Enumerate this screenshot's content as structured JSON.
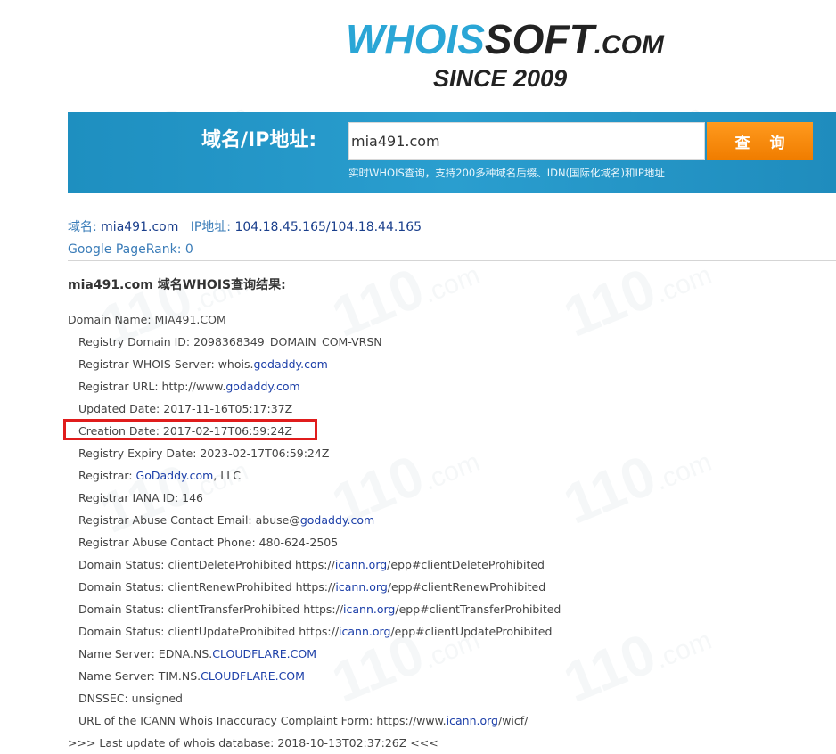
{
  "logo": {
    "whois": "WHOIS",
    "soft": "SOFT",
    "com": ".COM",
    "since": "SINCE 2009"
  },
  "watermark": {
    "text": "110",
    "suffix": ".com"
  },
  "search": {
    "label": "域名/IP地址:",
    "value": "mia491.com",
    "button": "查 询",
    "hint": "实时WHOIS查询，支持200多种域名后缀、IDN(国际化域名)和IP地址"
  },
  "domain_info": {
    "domain_label": "域名:",
    "domain_value": "mia491.com",
    "ip_label": "IP地址:",
    "ip_value": "104.18.45.165/104.18.44.165",
    "pagerank_label": "Google PageRank:",
    "pagerank_value": "0"
  },
  "result_title": "mia491.com 域名WHOIS查询结果:",
  "whois": {
    "domain_name": "Domain Name: MIA491.COM",
    "registry_domain_id": "Registry Domain ID: 2098368349_DOMAIN_COM-VRSN",
    "whois_server_prefix": "Registrar WHOIS Server: whois.",
    "whois_server_link": "godaddy.com",
    "registrar_url_prefix": "Registrar URL: http://www.",
    "registrar_url_link": "godaddy.com",
    "updated_date": "Updated Date: 2017-11-16T05:17:37Z",
    "creation_date": "Creation Date: 2017-02-17T06:59:24Z",
    "expiry_date": "Registry Expiry Date: 2023-02-17T06:59:24Z",
    "registrar_prefix": "Registrar: ",
    "registrar_link": "GoDaddy.com",
    "registrar_suffix": ", LLC",
    "iana_id": "Registrar IANA ID: 146",
    "abuse_email_prefix": "Registrar Abuse Contact Email: abuse@",
    "abuse_email_link": "godaddy.com",
    "abuse_phone": "Registrar Abuse Contact Phone: 480-624-2505",
    "statuses": [
      {
        "prefix": "Domain Status: clientDeleteProhibited https://",
        "link": "icann.org",
        "suffix": "/epp#clientDeleteProhibited"
      },
      {
        "prefix": "Domain Status: clientRenewProhibited https://",
        "link": "icann.org",
        "suffix": "/epp#clientRenewProhibited"
      },
      {
        "prefix": "Domain Status: clientTransferProhibited https://",
        "link": "icann.org",
        "suffix": "/epp#clientTransferProhibited"
      },
      {
        "prefix": "Domain Status: clientUpdateProhibited https://",
        "link": "icann.org",
        "suffix": "/epp#clientUpdateProhibited"
      }
    ],
    "name_servers": [
      {
        "prefix": "Name Server: EDNA.NS.",
        "link": "CLOUDFLARE.COM"
      },
      {
        "prefix": "Name Server: TIM.NS.",
        "link": "CLOUDFLARE.COM"
      }
    ],
    "dnssec": "DNSSEC: unsigned",
    "complaint_prefix": "URL of the ICANN Whois Inaccuracy Complaint Form: https://www.",
    "complaint_link": "icann.org",
    "complaint_suffix": "/wicf/",
    "last_update": ">>> Last update of whois database: 2018-10-13T02:37:26Z <<<"
  },
  "colors": {
    "banner": "#2a9ecf",
    "button": "#f48a0a",
    "link": "#1b3ea8",
    "highlight": "#e01c1c"
  }
}
